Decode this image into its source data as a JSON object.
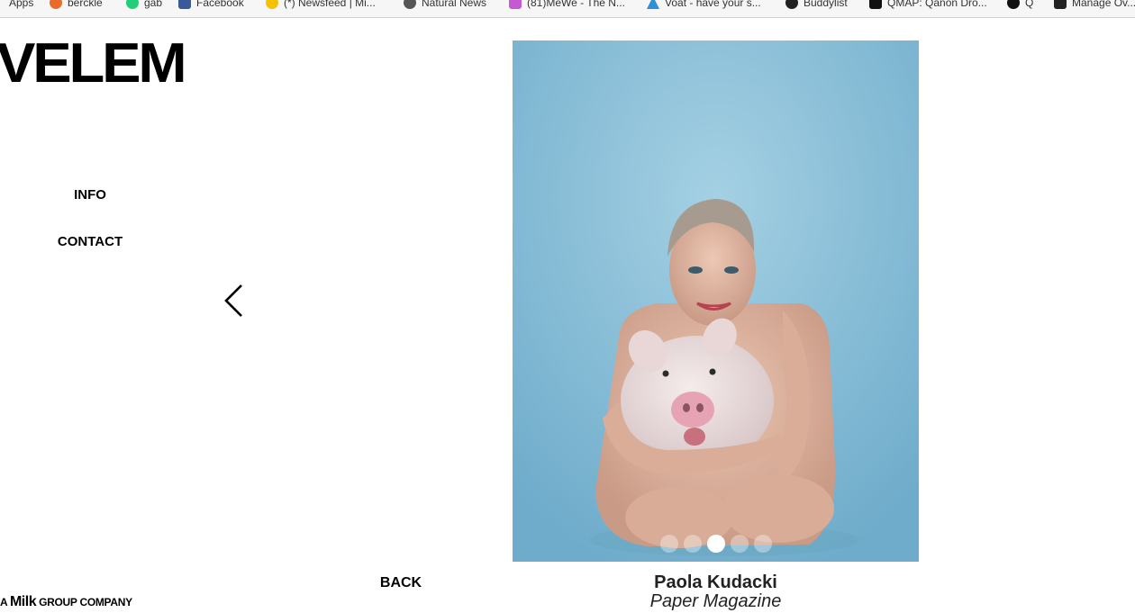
{
  "bookmarks": [
    {
      "label": "Apps",
      "icon": "apps-grid-icon",
      "color": "#4a7bd0"
    },
    {
      "label": "berckle",
      "icon": "browser-icon",
      "color": "#e86b2a"
    },
    {
      "label": "gab",
      "icon": "gab-icon",
      "color": "#21cf7a"
    },
    {
      "label": "Facebook",
      "icon": "facebook-icon",
      "color": "#3b5998"
    },
    {
      "label": "(*) Newsfeed | Mi...",
      "icon": "lightbulb-icon",
      "color": "#f2c200"
    },
    {
      "label": "Natural News",
      "icon": "natural-news-icon",
      "color": "#555555"
    },
    {
      "label": "(81)MeWe - The N...",
      "icon": "mewe-icon",
      "color": "#c45ad1"
    },
    {
      "label": "Voat - have your s...",
      "icon": "voat-icon",
      "color": "#2f8fd8"
    },
    {
      "label": "Buddylist",
      "icon": "buddylist-icon",
      "color": "#222222"
    },
    {
      "label": "QMAP: Qanon Dro...",
      "icon": "qmap-icon",
      "color": "#111111"
    },
    {
      "label": "Q",
      "icon": "q-icon",
      "color": "#111111"
    },
    {
      "label": "Manage Ov...",
      "icon": "manage-icon",
      "color": "#222222"
    }
  ],
  "site": {
    "logo": "VELEM",
    "nav": [
      {
        "label": "INFO"
      },
      {
        "label": "CONTACT"
      }
    ],
    "back_label": "BACK",
    "footer_prefix": "A ",
    "footer_brand": "Milk",
    "footer_suffix": " GROUP COMPANY"
  },
  "gallery": {
    "photographer": "Paola Kudacki",
    "publication": "Paper Magazine",
    "slide_count": 5,
    "active_slide_index": 2
  },
  "colors": {
    "photo_background": "#86bdd6",
    "text": "#000000"
  }
}
